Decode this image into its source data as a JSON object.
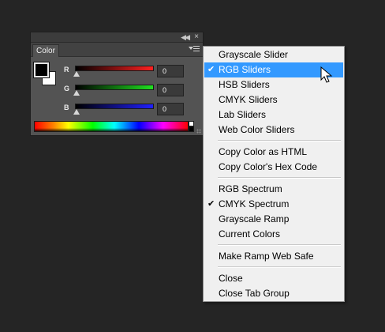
{
  "panel": {
    "tab_label": "Color",
    "collapse_glyph": "◀◀",
    "close_glyph": "×",
    "foreground_color": "#000000",
    "background_color": "#ffffff",
    "sliders": [
      {
        "label": "R",
        "value": "0",
        "track_color": "#e0202a"
      },
      {
        "label": "G",
        "value": "0",
        "track_color": "#20c020"
      },
      {
        "label": "B",
        "value": "0",
        "track_color": "#2020d0"
      }
    ]
  },
  "menu": {
    "items": [
      {
        "label": "Grayscale Slider",
        "checked": false
      },
      {
        "label": "RGB Sliders",
        "checked": true,
        "highlighted": true
      },
      {
        "label": "HSB Sliders",
        "checked": false
      },
      {
        "label": "CMYK Sliders",
        "checked": false
      },
      {
        "label": "Lab Sliders",
        "checked": false
      },
      {
        "label": "Web Color Sliders",
        "checked": false
      },
      {
        "label": "Copy Color as HTML",
        "checked": false
      },
      {
        "label": "Copy Color's Hex Code",
        "checked": false
      },
      {
        "label": "RGB Spectrum",
        "checked": false
      },
      {
        "label": "CMYK Spectrum",
        "checked": true
      },
      {
        "label": "Grayscale Ramp",
        "checked": false
      },
      {
        "label": "Current Colors",
        "checked": false
      },
      {
        "label": "Make Ramp Web Safe",
        "checked": false
      },
      {
        "label": "Close",
        "checked": false
      },
      {
        "label": "Close Tab Group",
        "checked": false
      }
    ],
    "check_glyph": "✔",
    "highlight_color": "#3399ff"
  }
}
